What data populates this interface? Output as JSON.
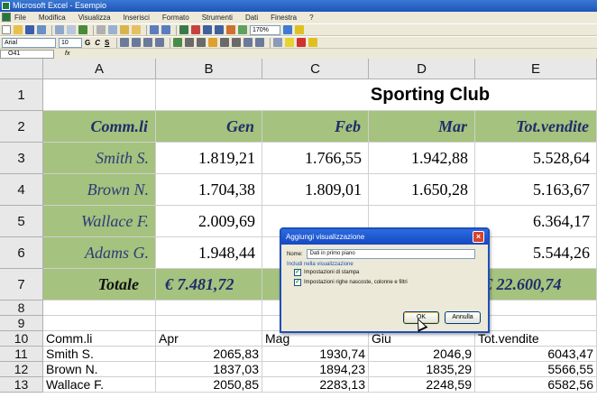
{
  "window": {
    "title": "Microsoft Excel - Esempio"
  },
  "menubar": [
    "File",
    "Modifica",
    "Visualizza",
    "Inserisci",
    "Formato",
    "Strumenti",
    "Dati",
    "Finestra",
    "?"
  ],
  "toolbar": {
    "zoom": "170%",
    "font": "Arial",
    "font_size": "10",
    "bold": "G",
    "italic": "C",
    "underline": "S"
  },
  "formula_bar": {
    "name_box": "O41",
    "fx": "fx"
  },
  "columns": [
    "A",
    "B",
    "C",
    "D",
    "E"
  ],
  "rows": {
    "r1": {
      "num": "1",
      "title": "Sporting Club"
    },
    "r2": {
      "num": "2",
      "cells": [
        "Comm.li",
        "Gen",
        "Feb",
        "Mar",
        "Tot.vendite"
      ]
    },
    "r3": {
      "num": "3",
      "cells": [
        "Smith S.",
        "1.819,21",
        "1.766,55",
        "1.942,88",
        "5.528,64"
      ]
    },
    "r4": {
      "num": "4",
      "cells": [
        "Brown N.",
        "1.704,38",
        "1.809,01",
        "1.650,28",
        "5.163,67"
      ]
    },
    "r5": {
      "num": "5",
      "cells": [
        "Wallace F.",
        "2.009,69",
        "",
        "",
        "6.364,17"
      ]
    },
    "r6": {
      "num": "6",
      "cells": [
        "Adams G.",
        "1.948,44",
        "",
        "",
        "5.544,26"
      ]
    },
    "r7": {
      "num": "7",
      "cells": [
        "Totale",
        "€ 7.481,72",
        "",
        "",
        "€ 22.600,74"
      ]
    },
    "r8": {
      "num": "8"
    },
    "r9": {
      "num": "9"
    },
    "r10": {
      "num": "10",
      "cells": [
        "Comm.li",
        "Apr",
        "Mag",
        "Giu",
        "Tot.vendite"
      ]
    },
    "r11": {
      "num": "11",
      "cells": [
        "Smith S.",
        "2065,83",
        "1930,74",
        "2046,9",
        "6043,47"
      ]
    },
    "r12": {
      "num": "12",
      "cells": [
        "Brown N.",
        "1837,03",
        "1894,23",
        "1835,29",
        "5566,55"
      ]
    },
    "r13": {
      "num": "13",
      "cells": [
        "Wallace F.",
        "2050,85",
        "2283,13",
        "2248,59",
        "6582,56"
      ]
    }
  },
  "dialog": {
    "title": "Aggiungi visualizzazione",
    "name_label": "Nome:",
    "name_value": "Dati in primo piano",
    "group_label": "Includi nella visualizzazione",
    "check1": "Impostazioni di stampa",
    "check2": "Impostazioni righe nascoste, colonne e filtri",
    "ok": "OK",
    "cancel": "Annulla",
    "close": "×"
  }
}
